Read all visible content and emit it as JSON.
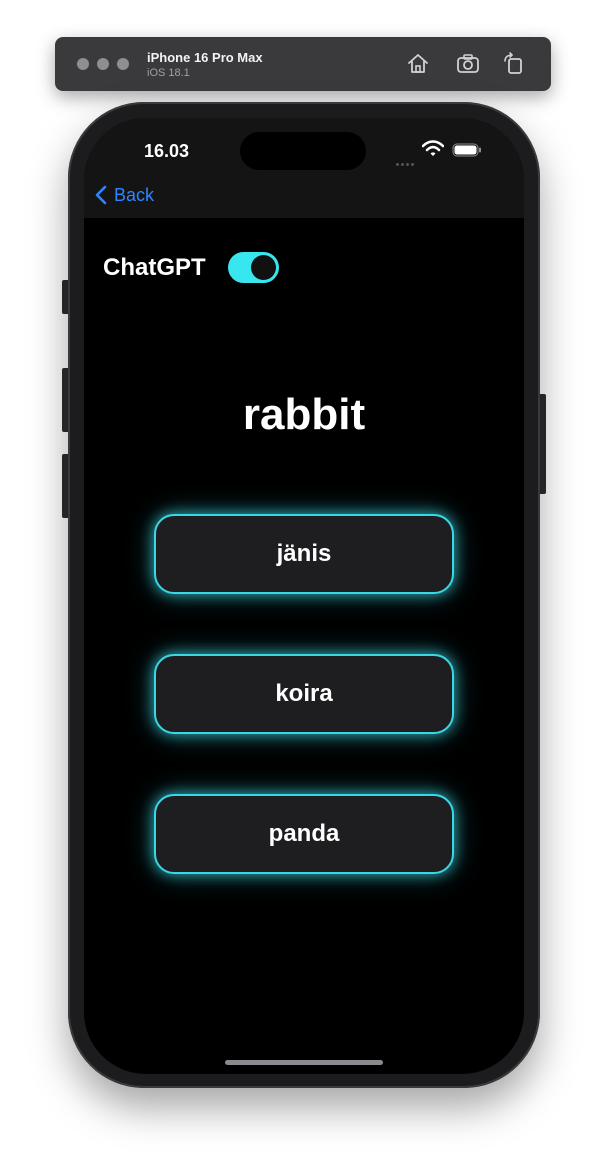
{
  "simulator": {
    "device_name": "iPhone 16 Pro Max",
    "os_version": "iOS 18.1"
  },
  "status_bar": {
    "time": "16.03"
  },
  "nav": {
    "back_label": "Back"
  },
  "settings": {
    "chatgpt_label": "ChatGPT",
    "chatgpt_enabled": true
  },
  "quiz": {
    "word": "rabbit",
    "options": [
      {
        "label": "jänis"
      },
      {
        "label": "koira"
      },
      {
        "label": "panda"
      }
    ]
  },
  "colors": {
    "accent_glow": "#3ad7e4",
    "toggle_on": "#38e6ef",
    "back_link": "#2f84ff"
  }
}
